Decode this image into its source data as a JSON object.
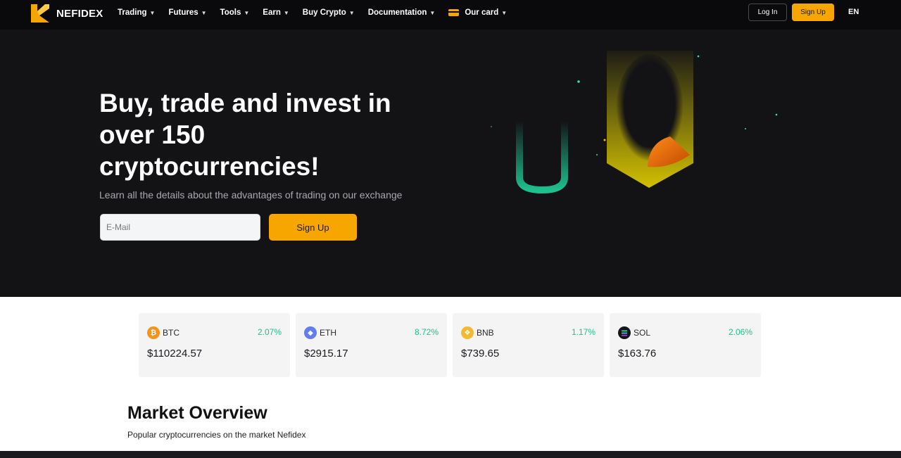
{
  "brand": {
    "name": "NEFIDEX",
    "accent": "#f7a600"
  },
  "nav": {
    "items": [
      {
        "label": "Trading"
      },
      {
        "label": "Futures"
      },
      {
        "label": "Tools"
      },
      {
        "label": "Earn"
      },
      {
        "label": "Buy Crypto"
      },
      {
        "label": "Documentation"
      },
      {
        "label": "Our card",
        "icon": "card-icon"
      }
    ],
    "login_label": "Log In",
    "signup_label": "Sign Up",
    "language": "EN"
  },
  "hero": {
    "title": "Buy, trade and invest in over 150 cryptocurrencies!",
    "subtitle": "Learn all the details about the advantages of trading on our exchange",
    "email_placeholder": "E-Mail",
    "signup_label": "Sign Up"
  },
  "tickers": [
    {
      "symbol": "BTC",
      "change": "2.07%",
      "price": "$110224.57",
      "icon": "bitcoin-icon",
      "color": "#f7931a"
    },
    {
      "symbol": "ETH",
      "change": "8.72%",
      "price": "$2915.17",
      "icon": "ethereum-icon",
      "color": "#627eea"
    },
    {
      "symbol": "BNB",
      "change": "1.17%",
      "price": "$739.65",
      "icon": "bnb-icon",
      "color": "#f3ba2f"
    },
    {
      "symbol": "SOL",
      "change": "2.06%",
      "price": "$163.76",
      "icon": "solana-icon",
      "color": "#14151a"
    }
  ],
  "market_overview": {
    "title": "Market Overview",
    "subtitle": "Popular cryptocurrencies on the market Nefidex"
  }
}
